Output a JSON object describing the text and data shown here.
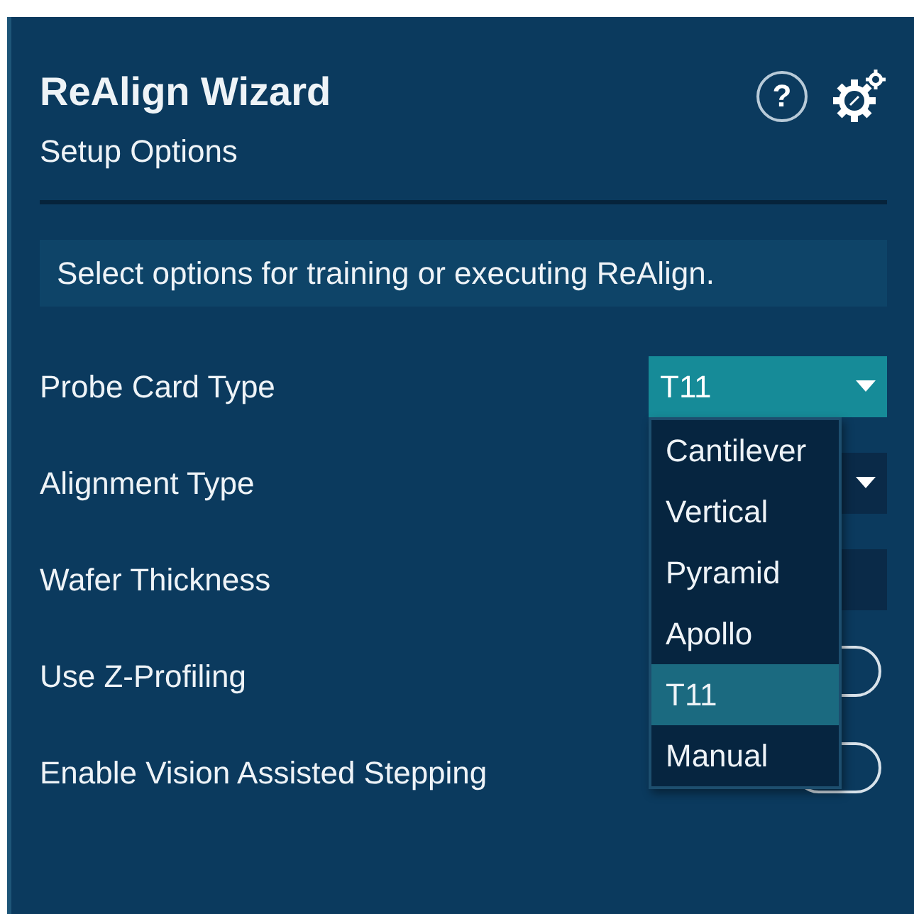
{
  "header": {
    "title": "ReAlign Wizard",
    "subtitle": "Setup Options",
    "help": "?"
  },
  "info": "Select options for training or executing ReAlign.",
  "options": [
    {
      "kind": "dropdown",
      "label": "Probe Card Type",
      "value": "T11",
      "open": true,
      "menu": [
        {
          "label": "Cantilever",
          "selected": false
        },
        {
          "label": "Vertical",
          "selected": false
        },
        {
          "label": "Pyramid",
          "selected": false
        },
        {
          "label": "Apollo",
          "selected": false
        },
        {
          "label": "T11",
          "selected": true
        },
        {
          "label": "Manual",
          "selected": false
        }
      ]
    },
    {
      "kind": "dropdown",
      "label": "Alignment Type",
      "open": false
    },
    {
      "kind": "field",
      "label": "Wafer Thickness"
    },
    {
      "kind": "toggle",
      "label": "Use Z-Profiling",
      "on": false
    },
    {
      "kind": "toggle",
      "label": "Enable Vision Assisted Stepping",
      "on": false
    }
  ]
}
